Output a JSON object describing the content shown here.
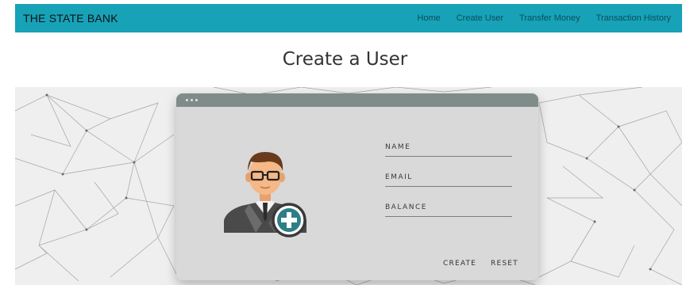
{
  "navbar": {
    "brand": "THE STATE BANK",
    "links": [
      "Home",
      "Create User",
      "Transfer Money",
      "Transaction History"
    ],
    "color": "#17a2b8"
  },
  "page": {
    "title": "Create a User"
  },
  "form": {
    "fields": [
      {
        "label": "NAME",
        "value": ""
      },
      {
        "label": "EMAIL",
        "value": ""
      },
      {
        "label": "BALANCE",
        "value": ""
      }
    ],
    "create_label": "CREATE",
    "reset_label": "RESET"
  },
  "icons": {
    "avatar": "user-add-icon",
    "plus": "plus-icon"
  }
}
